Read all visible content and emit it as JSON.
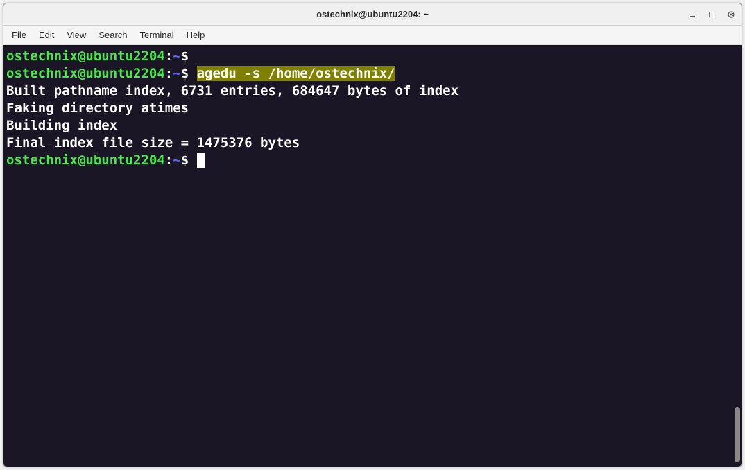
{
  "window": {
    "title": "ostechnix@ubuntu2204: ~"
  },
  "menubar": {
    "items": [
      "File",
      "Edit",
      "View",
      "Search",
      "Terminal",
      "Help"
    ]
  },
  "terminal": {
    "prompt": {
      "user": "ostechnix",
      "at": "@",
      "host": "ubuntu2204",
      "colon": ":",
      "path": "~",
      "dollar": "$"
    },
    "command": "agedu -s /home/ostechnix/",
    "output_lines": [
      "Built pathname index, 6731 entries, 684647 bytes of index",
      "Faking directory atimes",
      "Building index",
      "Final index file size = 1475376 bytes"
    ]
  }
}
